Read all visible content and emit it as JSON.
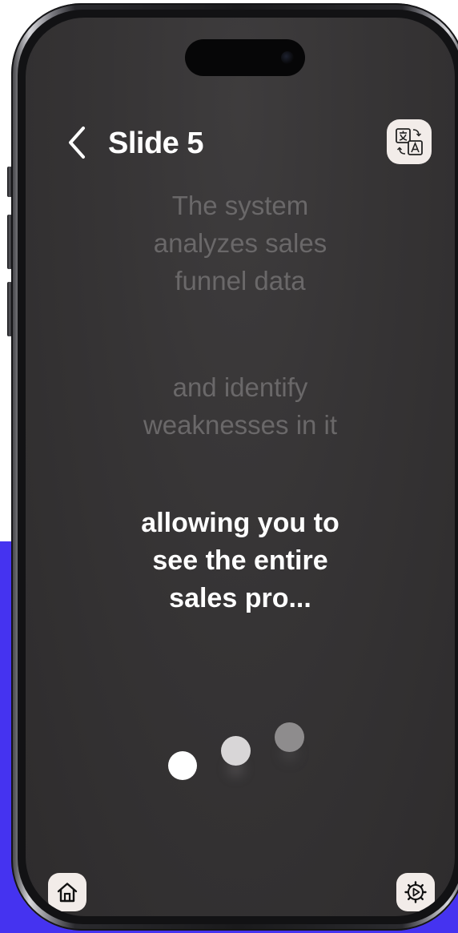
{
  "header": {
    "title": "Slide 5"
  },
  "transcript": {
    "previous_1": [
      "The system",
      "analyzes sales",
      "funnel data"
    ],
    "previous_2": [
      "and identify",
      "weaknesses in it"
    ],
    "current": [
      "allowing you to",
      "see the entire",
      "sales pro..."
    ]
  },
  "colors": {
    "background_accent": "#4533f0",
    "screen": "#363435",
    "button_bg": "#f2ece9",
    "dim_text": "#6a6869",
    "active_text": "#ffffff"
  },
  "icons": {
    "back": "chevron-left-icon",
    "translate": "translate-icon",
    "home": "home-icon",
    "settings": "gear-icon"
  }
}
